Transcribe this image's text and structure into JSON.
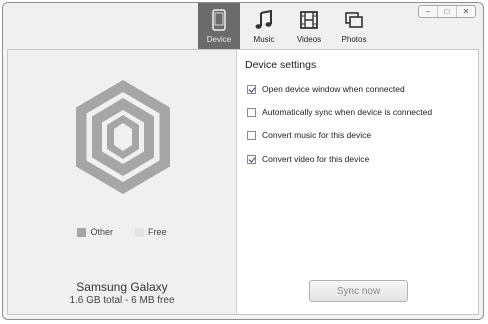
{
  "tabs": [
    {
      "label": "Device",
      "icon": "phone-icon",
      "active": true
    },
    {
      "label": "Music",
      "icon": "music-note-icon",
      "active": false
    },
    {
      "label": "Videos",
      "icon": "film-icon",
      "active": false
    },
    {
      "label": "Photos",
      "icon": "photos-icon",
      "active": false
    }
  ],
  "window_buttons": {
    "minimize": "–",
    "maximize": "□",
    "close": "✕"
  },
  "storage": {
    "legend": [
      {
        "label": "Other",
        "color": "#a6a6a6"
      },
      {
        "label": "Free",
        "color": "#e3e3e3"
      }
    ],
    "device_name": "Samsung Galaxy",
    "capacity_text": "1.6 GB total - 6 MB free"
  },
  "settings": {
    "title": "Device settings",
    "items": [
      {
        "label": "Open device window when connected",
        "checked": true
      },
      {
        "label": "Automatically sync when device is connected",
        "checked": false
      },
      {
        "label": "Convert music for this device",
        "checked": false
      },
      {
        "label": "Convert video for this device",
        "checked": true
      }
    ]
  },
  "sync_button": {
    "label": "Sync now",
    "enabled": false
  },
  "colors": {
    "active_tab": "#6b6b6b",
    "hex_outer": "#a6a6a6"
  }
}
